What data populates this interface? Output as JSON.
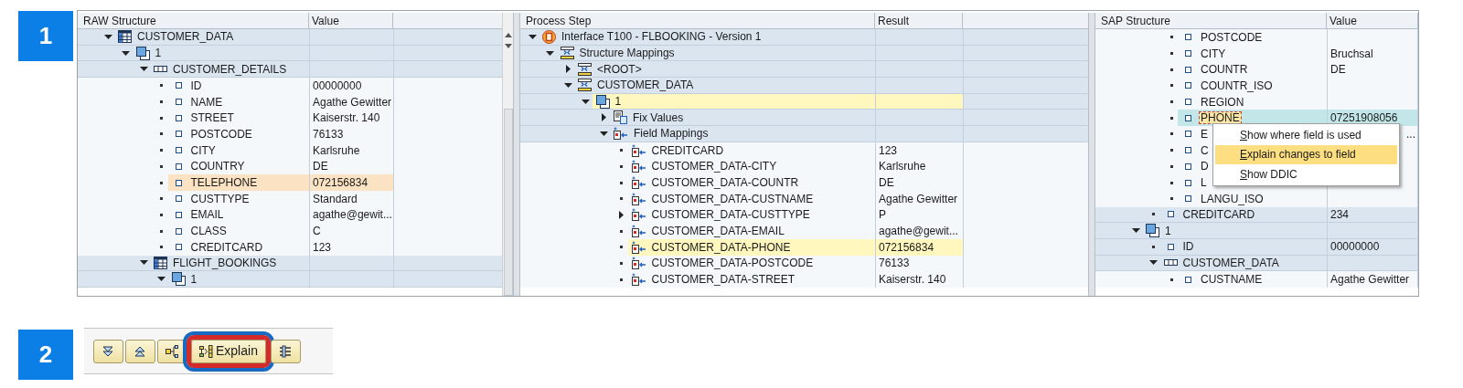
{
  "step_1": {
    "badge": "1",
    "panes": [
      {
        "kind": "raw",
        "columns": [
          "RAW Structure",
          "Value"
        ],
        "items": [
          {
            "label": "CUSTOMER_DATA",
            "kind": "table",
            "expanded": true,
            "selected": false,
            "children": [
              {
                "label": "1",
                "kind": "instance",
                "expanded": true,
                "selected": false,
                "children": [
                  {
                    "label": "CUSTOMER_DETAILS",
                    "kind": "structure",
                    "expanded": true,
                    "selected": false,
                    "children": [
                      {
                        "label": "ID",
                        "kind": "field",
                        "value": "00000000",
                        "selected": false
                      },
                      {
                        "label": "NAME",
                        "kind": "field",
                        "value": "Agathe Gewitter",
                        "selected": false
                      },
                      {
                        "label": "STREET",
                        "kind": "field",
                        "value": "Kaiserstr. 140",
                        "selected": false
                      },
                      {
                        "label": "POSTCODE",
                        "kind": "field",
                        "value": "76133",
                        "selected": false
                      },
                      {
                        "label": "CITY",
                        "kind": "field",
                        "value": "Karlsruhe",
                        "selected": false
                      },
                      {
                        "label": "COUNTRY",
                        "kind": "field",
                        "value": "DE",
                        "selected": false
                      },
                      {
                        "label": "TELEPHONE",
                        "kind": "field",
                        "value": "072156834",
                        "selected": true
                      },
                      {
                        "label": "CUSTTYPE",
                        "kind": "field",
                        "value": "Standard",
                        "selected": false
                      },
                      {
                        "label": "EMAIL",
                        "kind": "field",
                        "value": "agathe@gewit...",
                        "selected": false
                      },
                      {
                        "label": "CLASS",
                        "kind": "field",
                        "value": "C",
                        "selected": false
                      },
                      {
                        "label": "CREDITCARD",
                        "kind": "field",
                        "value": "123",
                        "selected": false
                      }
                    ]
                  },
                  {
                    "label": "FLIGHT_BOOKINGS",
                    "kind": "table",
                    "expanded": true,
                    "selected": false,
                    "children": [
                      {
                        "label": "1",
                        "kind": "instance",
                        "expanded": true,
                        "selected": false
                      }
                    ]
                  }
                ]
              }
            ]
          }
        ]
      },
      {
        "kind": "process",
        "columns": [
          "Process Step",
          "Result"
        ],
        "items": [
          {
            "label": "Interface T100 - FLBOOKING - Version 1",
            "kind": "interface",
            "expanded": true,
            "selected": false,
            "children": [
              {
                "label": "Structure Mappings",
                "kind": "structure-mapping",
                "expanded": true,
                "selected": false,
                "children": [
                  {
                    "label": "<ROOT>",
                    "kind": "structure-mapping",
                    "expanded": false,
                    "selected": false
                  },
                  {
                    "label": "CUSTOMER_DATA",
                    "kind": "structure-mapping",
                    "expanded": true,
                    "selected": false,
                    "children": [
                      {
                        "label": "1",
                        "kind": "instance",
                        "expanded": true,
                        "selected": true,
                        "children": [
                          {
                            "label": "Fix Values",
                            "kind": "fix-values",
                            "expanded": false,
                            "selected": false
                          },
                          {
                            "label": "Field Mappings",
                            "kind": "field-mappings",
                            "expanded": true,
                            "selected": false,
                            "children": [
                              {
                                "label": "CREDITCARD",
                                "kind": "mapping-rule",
                                "value": "123",
                                "selected": false
                              },
                              {
                                "label": "CUSTOMER_DATA-CITY",
                                "kind": "mapping-rule",
                                "value": "Karlsruhe",
                                "selected": false
                              },
                              {
                                "label": "CUSTOMER_DATA-COUNTR",
                                "kind": "mapping-rule",
                                "value": "DE",
                                "selected": false
                              },
                              {
                                "label": "CUSTOMER_DATA-CUSTNAME",
                                "kind": "mapping-rule",
                                "value": "Agathe Gewitter",
                                "selected": false
                              },
                              {
                                "label": "CUSTOMER_DATA-CUSTTYPE",
                                "kind": "mapping-rule",
                                "value": "P",
                                "expanded": false,
                                "selected": false
                              },
                              {
                                "label": "CUSTOMER_DATA-EMAIL",
                                "kind": "mapping-rule",
                                "value": "agathe@gewit...",
                                "selected": false
                              },
                              {
                                "label": "CUSTOMER_DATA-PHONE",
                                "kind": "mapping-rule",
                                "value": "072156834",
                                "selected": true
                              },
                              {
                                "label": "CUSTOMER_DATA-POSTCODE",
                                "kind": "mapping-rule",
                                "value": "76133",
                                "selected": false
                              },
                              {
                                "label": "CUSTOMER_DATA-STREET",
                                "kind": "mapping-rule",
                                "value": "Kaiserstr. 140",
                                "selected": false
                              }
                            ]
                          }
                        ]
                      }
                    ]
                  }
                ]
              }
            ]
          }
        ]
      },
      {
        "kind": "sap",
        "columns": [
          "SAP Structure",
          "Value"
        ],
        "items": [
          {
            "children": [
              {
                "children": [
                  {
                    "label": "POSTCODE",
                    "kind": "field",
                    "selected": false
                  },
                  {
                    "label": "CITY",
                    "kind": "field",
                    "value": "Bruchsal",
                    "selected": false
                  },
                  {
                    "label": "COUNTR",
                    "kind": "field",
                    "value": "DE",
                    "selected": false
                  },
                  {
                    "label": "COUNTR_ISO",
                    "kind": "field",
                    "selected": false
                  },
                  {
                    "label": "REGION",
                    "kind": "field",
                    "selected": false
                  },
                  {
                    "label": "PHONE",
                    "kind": "field",
                    "value": "07251908056",
                    "selected": true,
                    "focused": true
                  },
                  {
                    "label": "E",
                    "kind": "field",
                    "value": "...",
                    "selected": false,
                    "obscured": true
                  },
                  {
                    "label": "C",
                    "kind": "field",
                    "selected": false
                  },
                  {
                    "label": "D",
                    "kind": "field",
                    "selected": false
                  },
                  {
                    "label": "L",
                    "kind": "field",
                    "selected": false
                  },
                  {
                    "label": "LANGU_ISO",
                    "kind": "field",
                    "selected": false
                  }
                ]
              },
              {
                "label": "CREDITCARD",
                "kind": "field",
                "value": "234",
                "selected": false,
                "banded": true
              }
            ]
          },
          {
            "label": "1",
            "kind": "instance",
            "expanded": true,
            "selected": false,
            "children": [
              {
                "label": "ID",
                "kind": "field",
                "value": "00000000",
                "selected": false,
                "banded": true
              },
              {
                "label": "CUSTOMER_DATA",
                "kind": "structure",
                "expanded": true,
                "selected": false,
                "children": [
                  {
                    "label": "CUSTNAME",
                    "kind": "field",
                    "value": "Agathe Gewitter",
                    "selected": false
                  }
                ]
              }
            ]
          }
        ]
      }
    ],
    "context_menu": {
      "items": [
        {
          "label": "Show where field is used",
          "selected": false
        },
        {
          "label": "Explain changes to field",
          "selected": true
        },
        {
          "label": "Show DDIC",
          "selected": false
        }
      ]
    }
  },
  "step_2": {
    "badge": "2",
    "toolbar": {
      "buttons": [
        {
          "kind": "expand-all",
          "focused": false
        },
        {
          "kind": "collapse-all",
          "focused": false
        },
        {
          "kind": "hierarchy",
          "focused": false
        },
        {
          "kind": "explain",
          "label": "Explain",
          "focused": true
        },
        {
          "kind": "tools",
          "focused": false
        }
      ]
    }
  }
}
